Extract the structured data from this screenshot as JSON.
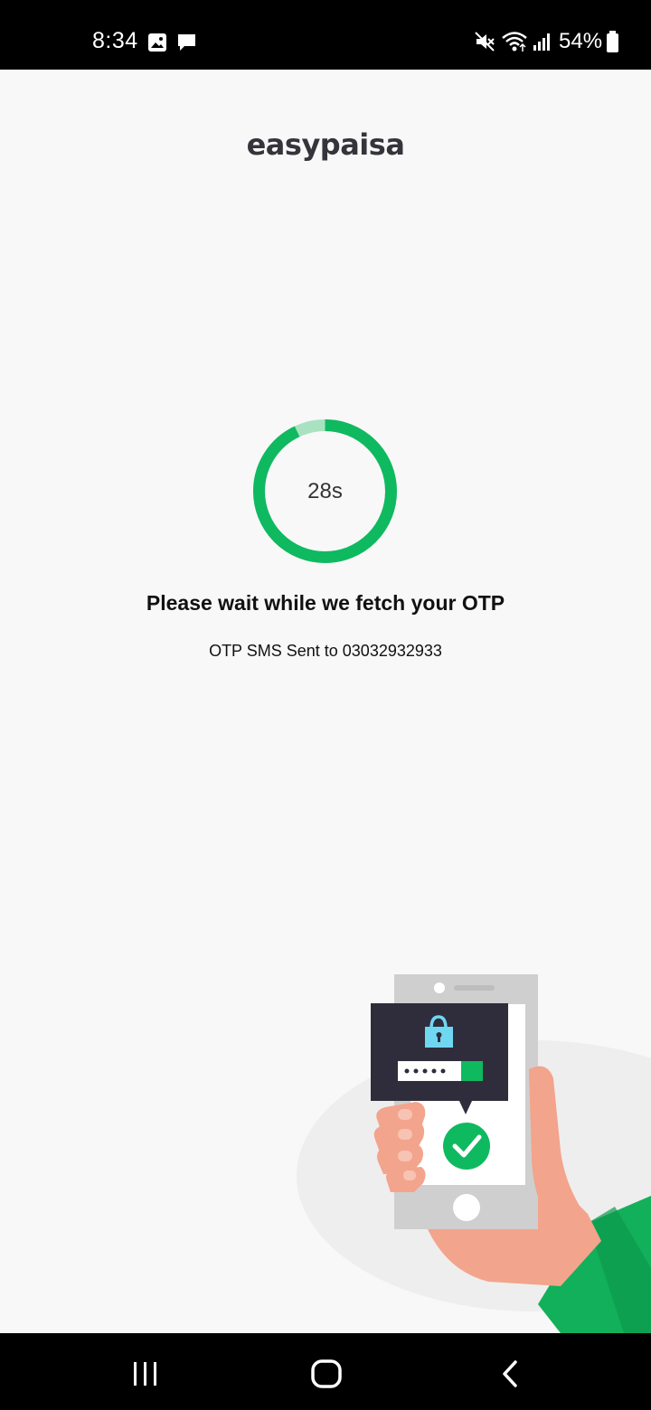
{
  "status_bar": {
    "time": "8:34",
    "battery": "54%",
    "icons": [
      "image-icon",
      "message-icon",
      "mute-icon",
      "wifi-icon",
      "signal-icon",
      "battery-icon"
    ]
  },
  "app": {
    "logo_text": "easypaisa",
    "brand_color": "#14b25a",
    "timer": {
      "label": "28s",
      "progress": 0.93
    },
    "title": "Please wait while we fetch your OTP",
    "subtitle": "OTP SMS Sent to 03032932933"
  },
  "nav_bar": {
    "buttons": [
      "recent-apps",
      "home",
      "back"
    ]
  }
}
